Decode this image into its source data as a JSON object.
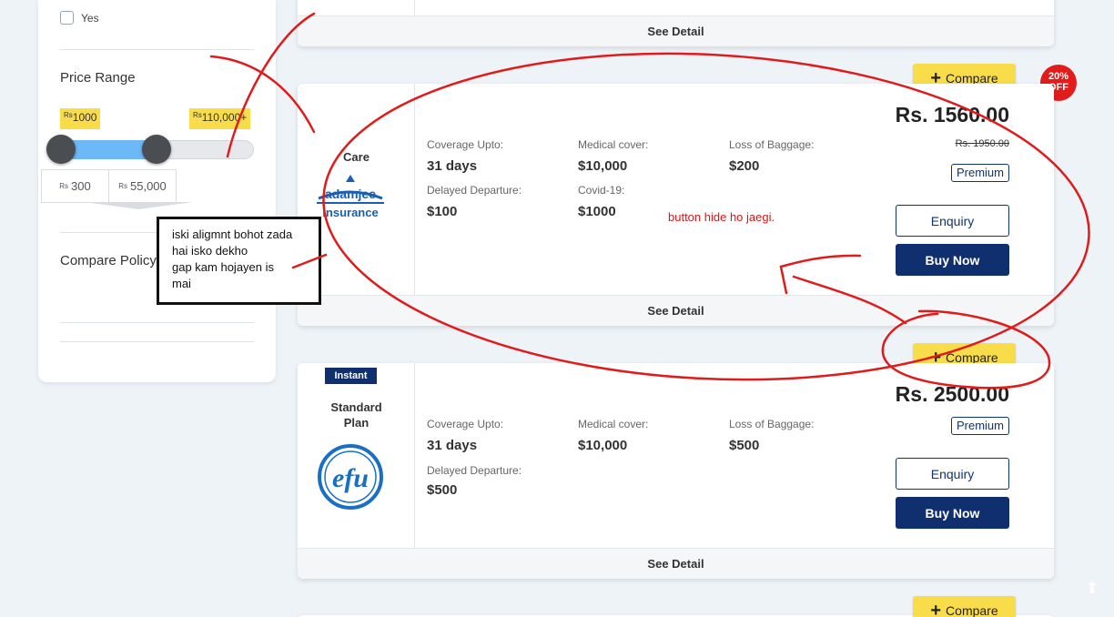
{
  "sidebar": {
    "yes_label": "Yes",
    "price_range_title": "Price Range",
    "range_min_tag": "1000",
    "range_max_tag": "110,000+",
    "currency_symbol": "Rs",
    "min_value": "300",
    "max_value": "55,000",
    "slider_range_fraction": [
      0.0,
      0.5
    ],
    "compare_policy_title": "Compare Policy"
  },
  "cards": [
    {
      "see_detail": "See Detail"
    },
    {
      "compare_label": "Compare",
      "discount_badge": "20%\nOFF",
      "company": "Care",
      "logo_text": "adamjee\ninsurance",
      "features": [
        {
          "label": "Coverage Upto:",
          "value": "31 days"
        },
        {
          "label": "Medical cover:",
          "value": "$10,000"
        },
        {
          "label": "Loss of Baggage:",
          "value": "$200"
        },
        {
          "label": "Delayed Departure:",
          "value": "$100"
        },
        {
          "label": "Covid-19:",
          "value": "$1000"
        }
      ],
      "price": "Rs. 1560.00",
      "old_price": "Rs. 1950.00",
      "tier": "Premium",
      "enquiry_label": "Enquiry",
      "buy_label": "Buy Now",
      "see_detail": "See Detail"
    },
    {
      "compare_label": "Compare",
      "instant_badge": "Instant",
      "company": "Standard\nPlan",
      "logo_text": "efu",
      "features": [
        {
          "label": "Coverage Upto:",
          "value": "31 days"
        },
        {
          "label": "Medical cover:",
          "value": "$10,000"
        },
        {
          "label": "Loss of Baggage:",
          "value": "$500"
        },
        {
          "label": "Delayed Departure:",
          "value": "$500"
        }
      ],
      "price": "Rs. 2500.00",
      "tier": "Premium",
      "enquiry_label": "Enquiry",
      "buy_label": "Buy Now",
      "see_detail": "See Detail"
    },
    {
      "compare_label": "Compare"
    }
  ],
  "annotations": {
    "note_box": "iski aligmnt bohot zada\nhai isko dekho\ngap kam hojayen is\nmai",
    "button_note": "button hide ho jaegi."
  },
  "colors": {
    "accent_yellow": "#f9dc4a",
    "primary_navy": "#0f2f6e",
    "annotation_red": "#d81818",
    "slider_fill": "#6db8f7",
    "page_bg": "#eef3f8"
  },
  "icons": [
    "plus-icon",
    "arrow-up-icon"
  ]
}
